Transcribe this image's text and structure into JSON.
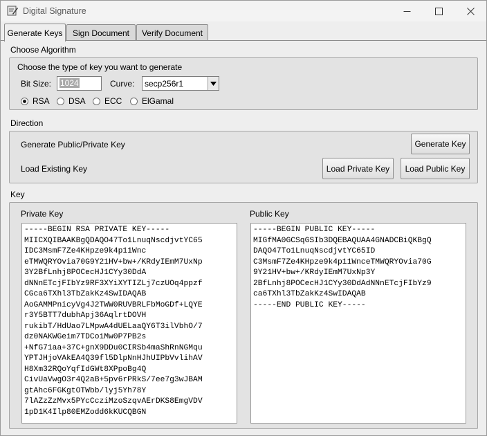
{
  "window": {
    "title": "Digital Signature"
  },
  "tabs": [
    {
      "label": "Generate Keys",
      "active": true
    },
    {
      "label": "Sign Document",
      "active": false
    },
    {
      "label": "Verify Document",
      "active": false
    }
  ],
  "algorithm": {
    "section_title": "Choose Algorithm",
    "prompt": "Choose the type of key you want to generate",
    "bit_size_label": "Bit Size:",
    "bit_size_value": "1024",
    "curve_label": "Curve:",
    "curve_value": "secp256r1",
    "options": [
      {
        "label": "RSA",
        "checked": true
      },
      {
        "label": "DSA",
        "checked": false
      },
      {
        "label": "ECC",
        "checked": false
      },
      {
        "label": "ElGamal",
        "checked": false
      }
    ]
  },
  "direction": {
    "section_title": "Direction",
    "generate_label": "Generate Public/Private Key",
    "generate_button": "Generate Key",
    "load_label": "Load Existing Key",
    "load_private_button": "Load Private Key",
    "load_public_button": "Load Public Key"
  },
  "key": {
    "section_title": "Key",
    "private_label": "Private Key",
    "public_label": "Public Key",
    "private_text": "-----BEGIN RSA PRIVATE KEY-----\nMIICXQIBAAKBgQDAQO47To1LnuqNscdjvtYC65\nIDC3MsmF7Ze4KHpze9k4p11Wnc\neTMWQRYOvia70G9Y21HV+bw+/KRdyIEmM7UxNp\n3Y2BfLnhj8POCecHJ1CYy30DdA\ndNNnETcjFIbYz9RF3XYiXYTIZLj7czUOq4ppzf\nCGca6TXhl3TbZakKz4SwIDAQAB\nAoGAMMPnicyVg4J2TWW0RUVBRLFbMoGDf+LQYE\nr3Y5BTT7dubhApj36AqlrtDOVH\nrukibT/HdUao7LMpwA4dUELaaQY6T3ilVbhO/7\ndz0NAKWGeim7TDCoiMw0P7PB2s\n+NfG71aa+37C+gnX9DDu0CIRSb4maShRnNGMqu\nYPTJHjoVAkEA4Q39fl5DlpNnHJhUIPbVvlihAV\nH8Xm32RQoYqfIdGWt8XPpoBg4Q\nCivUaVwgO3r4Q2aB+5pv6rPRkS/7ee7g3wJBAM\ngtAhc6FGKgtOTWbb/lyj5Yh78Y\n7lAZzZzMvx5PYcCcziMzoSzqvAErDKS8EmgVDV\n1pD1K4Ilp80EMZodd6kKUCQBGN",
    "public_text": "-----BEGIN PUBLIC KEY-----\nMIGfMA0GCSqGSIb3DQEBAQUAA4GNADCBiQKBgQ\nDAQO47To1LnuqNscdjvtYC65ID\nC3MsmF7Ze4KHpze9k4p11WnceTMWQRYOvia70G\n9Y21HV+bw+/KRdyIEmM7UxNp3Y\n2BfLnhj8POCecHJ1CYy30DdAdNNnETcjFIbYz9\nca6TXhl3TbZakKz4SwIDAQAB\n-----END PUBLIC KEY-----"
  }
}
